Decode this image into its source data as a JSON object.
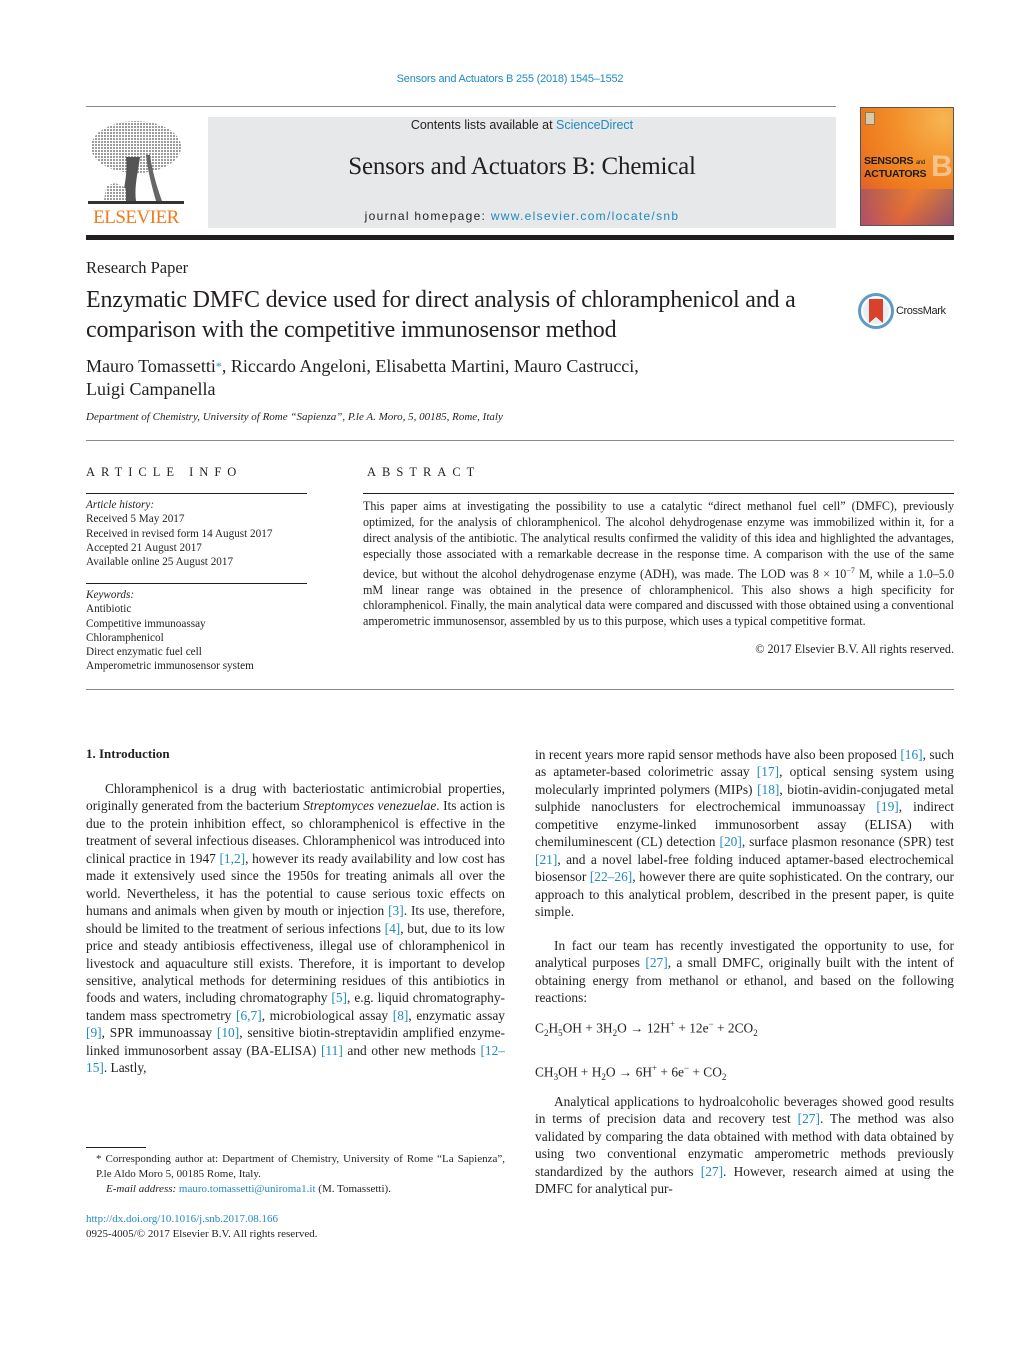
{
  "header": {
    "journal_ref": "Sensors and Actuators B 255 (2018) 1545–1552",
    "contents_prefix": "Contents lists available at ",
    "contents_link": "ScienceDirect",
    "journal_title": "Sensors and Actuators B: Chemical",
    "homepage_prefix": "journal homepage: ",
    "homepage_link": "www.elsevier.com/locate/snb",
    "publisher_logo": "ELSEVIER",
    "cover_title_line1": "SENSORS",
    "cover_title_and": "and",
    "cover_title_line2": "ACTUATORS",
    "cover_letter": "B",
    "crossmark_label": "CrossMark"
  },
  "article": {
    "type": "Research Paper",
    "title": "Enzymatic DMFC device used for direct analysis of chloramphenicol and a comparison with the competitive immunosensor method",
    "authors_first": "Mauro Tomassetti",
    "author_mark": "*",
    "authors_rest": ", Riccardo Angeloni, Elisabetta Martini, Mauro Castrucci,",
    "authors_line2": "Luigi Campanella",
    "affiliation": "Department of Chemistry, University of Rome “Sapienza”, P.le A. Moro, 5, 00185, Rome, Italy"
  },
  "article_info": {
    "heading": "ARTICLE INFO",
    "history_label": "Article history:",
    "history": [
      "Received 5 May 2017",
      "Received in revised form 14 August 2017",
      "Accepted 21 August 2017",
      "Available online 25 August 2017"
    ],
    "keywords_label": "Keywords:",
    "keywords": [
      "Antibiotic",
      "Competitive immunoassay",
      "Chloramphenicol",
      "Direct enzymatic fuel cell",
      "Amperometric immunosensor system"
    ]
  },
  "abstract": {
    "heading": "ABSTRACT",
    "text_a": "This paper aims at investigating the possibility to use a catalytic “direct methanol fuel cell” (DMFC), previously optimized, for the analysis of chloramphenicol. The alcohol dehydrogenase enzyme was immobilized within it, for a direct analysis of the antibiotic. The analytical results confirmed the validity of this idea and highlighted the advantages, especially those associated with a remarkable decrease in the response time. A comparison with the use of the same device, but without the alcohol dehydrogenase enzyme (ADH), was made. The LOD was 8 × 10",
    "lod_exp": "−7",
    "text_b": " M, while a 1.0–5.0 mM linear range was obtained in the presence of chloramphenicol. This also shows a high specificity for chloramphenicol. Finally, the main analytical data were compared and discussed with those obtained using a conventional amperometric immunosensor, assembled by us to this purpose, which uses a typical competitive format.",
    "copyright": "© 2017 Elsevier B.V. All rights reserved."
  },
  "introduction": {
    "heading": "1.  Introduction",
    "left_column": [
      {
        "t": "Chloramphenicol is a drug with bacteriostatic antimicrobial properties, originally generated from the bacterium "
      },
      {
        "t": "Streptomyces venezuelae",
        "i": true
      },
      {
        "t": ". Its action is due to the protein inhibition effect, so chloramphenicol is effective in the treatment of several infectious diseases. Chloramphenicol was introduced into clinical practice in 1947 "
      },
      {
        "t": "[1,2]",
        "ref": true
      },
      {
        "t": ", however its ready availability and low cost has made it extensively used since the 1950s for treating animals all over the world. Nevertheless, it has the potential to cause serious toxic effects on humans and animals when given by mouth or injection "
      },
      {
        "t": "[3]",
        "ref": true
      },
      {
        "t": ". Its use, therefore, should be limited to the treatment of serious infections "
      },
      {
        "t": "[4]",
        "ref": true
      },
      {
        "t": ", but, due to its low price and steady antibiosis effectiveness, illegal use of chloramphenicol in livestock and aquaculture still exists. Therefore, it is important to develop sensitive, analytical methods for determining residues of this antibiotics in foods and waters, including chromatography "
      },
      {
        "t": "[5]",
        "ref": true
      },
      {
        "t": ", e.g. liquid chromatography-tandem mass spectrometry "
      },
      {
        "t": "[6,7]",
        "ref": true
      },
      {
        "t": ", microbiological assay "
      },
      {
        "t": "[8]",
        "ref": true
      },
      {
        "t": ", enzymatic assay "
      },
      {
        "t": "[9]",
        "ref": true
      },
      {
        "t": ", SPR immunoassay "
      },
      {
        "t": "[10]",
        "ref": true
      },
      {
        "t": ", sensitive biotin-streptavidin amplified enzyme-linked immunosorbent assay (BA-ELISA) "
      },
      {
        "t": "[11]",
        "ref": true
      },
      {
        "t": " and other new methods "
      },
      {
        "t": "[12–15]",
        "ref": true
      },
      {
        "t": ". Lastly,"
      }
    ],
    "right_column_a": [
      {
        "t": "in recent years more rapid sensor methods have also been proposed "
      },
      {
        "t": "[16]",
        "ref": true
      },
      {
        "t": ", such as aptameter-based colorimetric assay "
      },
      {
        "t": "[17]",
        "ref": true
      },
      {
        "t": ", optical sensing system using molecularly imprinted polymers (MIPs) "
      },
      {
        "t": "[18]",
        "ref": true
      },
      {
        "t": ", biotin-avidin-conjugated metal sulphide nanoclusters for electrochemical immunoassay "
      },
      {
        "t": "[19]",
        "ref": true
      },
      {
        "t": ", indirect competitive enzyme-linked immunosorbent assay (ELISA) with chemiluminescent (CL) detection "
      },
      {
        "t": "[20]",
        "ref": true
      },
      {
        "t": ", surface plasmon resonance (SPR) test "
      },
      {
        "t": "[21]",
        "ref": true
      },
      {
        "t": ", and a novel label-free folding induced aptamer-based electrochemical biosensor "
      },
      {
        "t": "[22–26]",
        "ref": true
      },
      {
        "t": ", however there are quite sophisticated. On the contrary, our approach to this analytical problem, described in the present paper, is quite simple."
      }
    ],
    "right_column_b": [
      {
        "t": "In fact our team has recently investigated the opportunity to use, for analytical purposes "
      },
      {
        "t": "[27]",
        "ref": true
      },
      {
        "t": ", a small DMFC, originally built with the intent of obtaining energy from methanol or ethanol, and based on the following reactions:"
      }
    ],
    "equations": [
      [
        {
          "t": "C"
        },
        {
          "t": "2",
          "sub": true
        },
        {
          "t": "H"
        },
        {
          "t": "5",
          "sub": true
        },
        {
          "t": "OH + 3H"
        },
        {
          "t": "2",
          "sub": true
        },
        {
          "t": "O → 12H"
        },
        {
          "t": "+",
          "sup": true
        },
        {
          "t": " + 12e"
        },
        {
          "t": "−",
          "sup": true
        },
        {
          "t": " + 2CO"
        },
        {
          "t": "2",
          "sub": true
        }
      ],
      [
        {
          "t": "CH"
        },
        {
          "t": "3",
          "sub": true
        },
        {
          "t": "OH + H"
        },
        {
          "t": "2",
          "sub": true
        },
        {
          "t": "O → 6H"
        },
        {
          "t": "+",
          "sup": true
        },
        {
          "t": " + 6e"
        },
        {
          "t": "−",
          "sup": true
        },
        {
          "t": " + CO"
        },
        {
          "t": "2",
          "sub": true
        }
      ]
    ],
    "right_column_c": [
      {
        "t": "Analytical applications to hydroalcoholic beverages showed good results in terms of precision data and recovery test "
      },
      {
        "t": "[27]",
        "ref": true
      },
      {
        "t": ". The method was also validated by comparing the data obtained with method with data obtained by using two conventional enzymatic amperometric methods previously standardized by the authors "
      },
      {
        "t": "[27]",
        "ref": true
      },
      {
        "t": ". However, research aimed at using the DMFC for analytical pur-"
      }
    ]
  },
  "footnote": {
    "mark": "*",
    "corresponding": " Corresponding author at: Department of Chemistry, University of Rome “La Sapienza”, P.le Aldo Moro 5, 00185 Rome, Italy.",
    "email_label": "E-mail address:",
    "email": "mauro.tomassetti@uniroma1.it",
    "email_suffix": " (M. Tomassetti).",
    "doi": "http://dx.doi.org/10.1016/j.snb.2017.08.166",
    "issn_line": "0925-4005/© 2017 Elsevier B.V. All rights reserved."
  },
  "colors": {
    "link": "#1f8ac0",
    "elsevier_orange": "#f07a1d",
    "masthead_bg": "#e7e8e9",
    "text": "#231f20"
  }
}
